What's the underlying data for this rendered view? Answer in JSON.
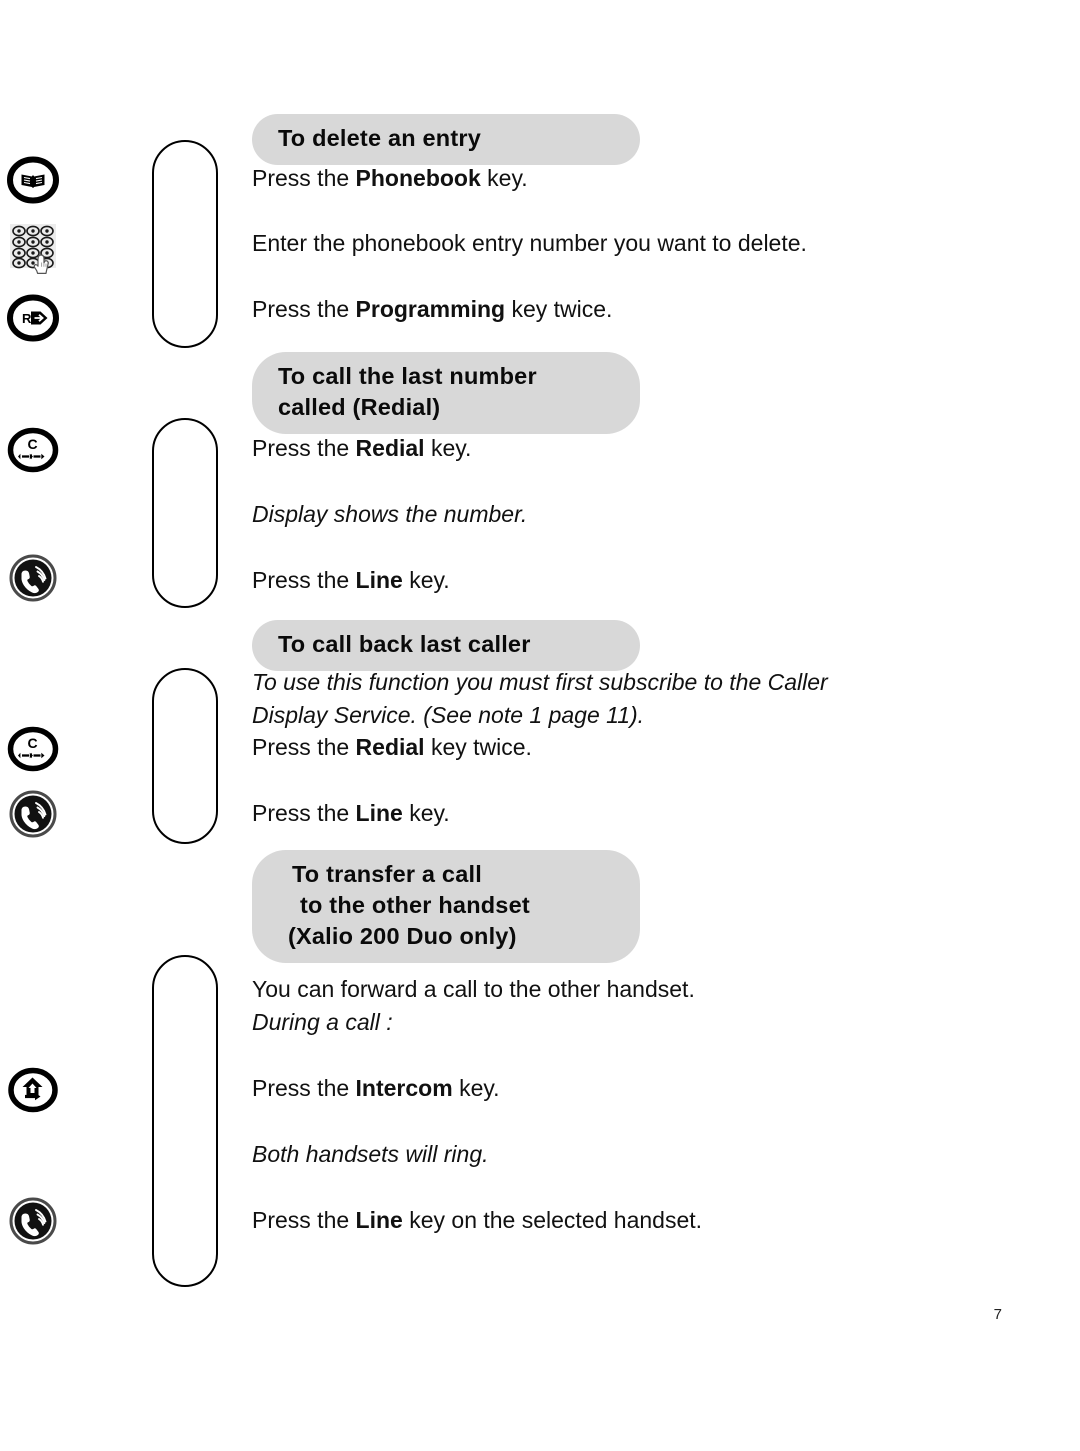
{
  "page": {
    "number": "7"
  },
  "sections": [
    {
      "id": "delete-entry",
      "heading": "To delete an entry",
      "lines": [
        {
          "text": "Press the Phonebook key.",
          "bold": "Phonebook",
          "style": "normal"
        },
        {
          "text": "Enter the phonebook entry number you want to delete.",
          "style": "normal"
        },
        {
          "text": "Press the Programming key twice.",
          "bold": "Programming",
          "style": "normal"
        }
      ],
      "icons": [
        "phonebook-key-icon",
        "keypad-icon",
        "programming-key-icon"
      ]
    },
    {
      "id": "redial",
      "heading_line1": "To call the last number",
      "heading_line2": "called (Redial)",
      "lines": [
        {
          "text": "Press the Redial key.",
          "bold": "Redial",
          "style": "normal"
        },
        {
          "text": "Display shows the number.",
          "style": "italic"
        },
        {
          "text": "Press the Line key.",
          "bold": "Line",
          "style": "normal"
        }
      ],
      "icons": [
        "redial-key-icon",
        "line-key-icon"
      ]
    },
    {
      "id": "call-back",
      "heading": "To call back last caller",
      "lines": [
        {
          "text": "To use this function you must first subscribe to the Caller",
          "style": "italic"
        },
        {
          "text": "Display Service. (See note 1 page 11).",
          "style": "italic"
        },
        {
          "text": "Press the Redial key twice.",
          "bold": "Redial",
          "style": "normal"
        },
        {
          "text": "Press the Line key.",
          "bold": "Line",
          "style": "normal"
        }
      ],
      "icons": [
        "redial-key-icon",
        "line-key-icon"
      ]
    },
    {
      "id": "transfer-call",
      "heading_line1": "To transfer a call",
      "heading_line2": "to the other handset",
      "heading_line3": "(Xalio 200 Duo only)",
      "lines": [
        {
          "text": "You can forward a call to the other handset.",
          "style": "normal"
        },
        {
          "text": "During a call :",
          "style": "italic"
        },
        {
          "text": "Press the Intercom key.",
          "bold": "Intercom",
          "style": "normal"
        },
        {
          "text": "Both handsets will ring.",
          "style": "italic"
        },
        {
          "text": "Press the Line key on the selected handset.",
          "bold": "Line",
          "style": "normal"
        }
      ],
      "icons": [
        "intercom-key-icon",
        "line-key-icon"
      ]
    }
  ],
  "colors": {
    "banner_bg": "#d8d8d8",
    "text": "#111111",
    "outline": "#000000",
    "keypad_bg": "#ebebeb"
  }
}
